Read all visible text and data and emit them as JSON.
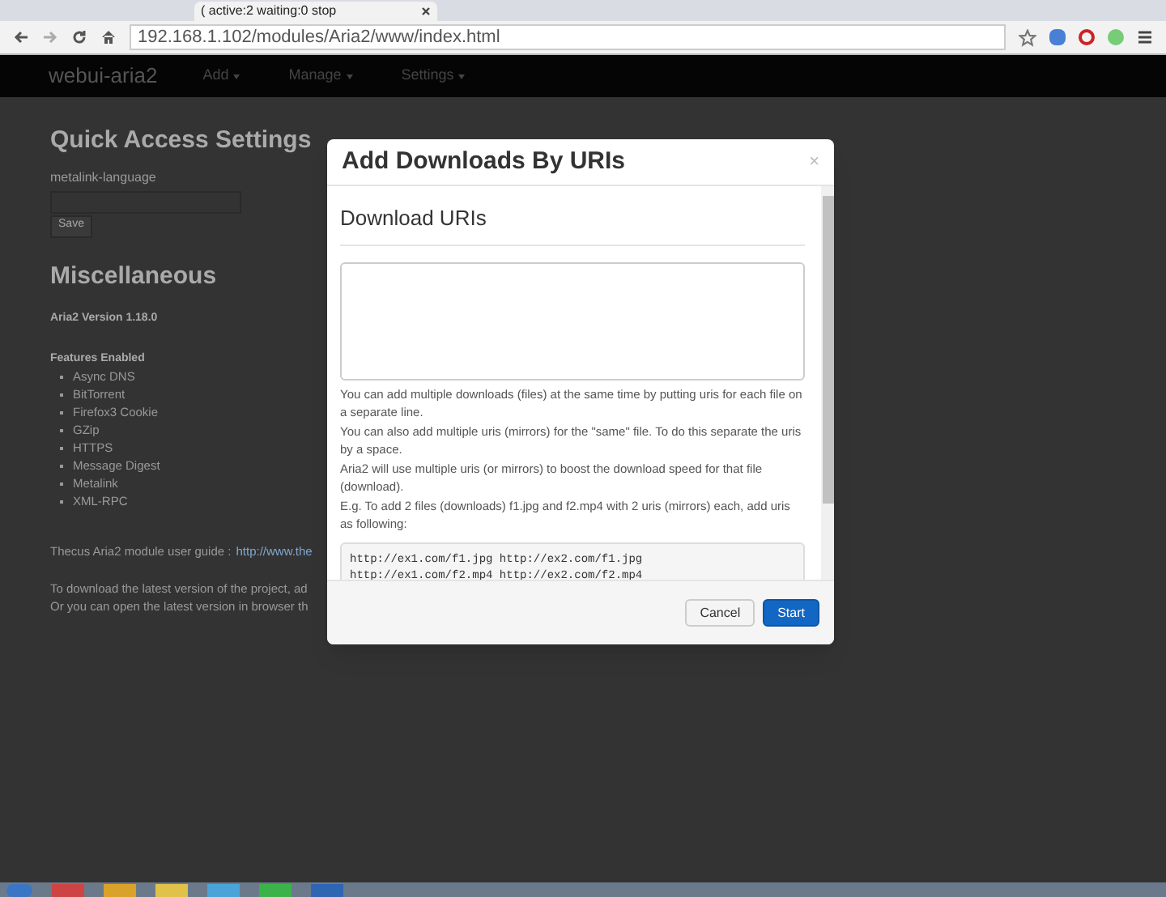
{
  "browser": {
    "tab_title": "( active:2 waiting:0 stop",
    "address": "192.168.1.102/modules/Aria2/www/index.html"
  },
  "navbar": {
    "brand": "webui-aria2",
    "menus": [
      {
        "label": "Add"
      },
      {
        "label": "Manage"
      },
      {
        "label": "Settings"
      }
    ]
  },
  "page": {
    "quick_access": {
      "heading": "Quick Access Settings",
      "field_label": "metalink-language",
      "save": "Save"
    },
    "misc": {
      "heading": "Miscellaneous",
      "version": "Aria2 Version 1.18.0",
      "features_heading": "Features Enabled",
      "features": [
        "Async DNS",
        "BitTorrent",
        "Firefox3 Cookie",
        "GZip",
        "HTTPS",
        "Message Digest",
        "Metalink",
        "XML-RPC"
      ],
      "guide_text": "Thecus Aria2 module user guide :",
      "guide_link": "http://www.the",
      "lines": [
        "To download the latest version of the project, ad",
        "Or you can open the latest version in browser th"
      ]
    }
  },
  "modal": {
    "title": "Add Downloads By URIs",
    "close": "×",
    "section": "Download URIs",
    "help": [
      "You can add multiple downloads (files) at the same time by putting uris for each file on a separate line.",
      "You can also add multiple uris (mirrors) for the \"same\" file. To do this separate the uris by a space.",
      "Aria2 will use multiple uris (or mirrors) to boost the download speed for that file (download).",
      "E.g. To add 2 files (downloads) f1.jpg and f2.mp4 with 2 uris (mirrors) each, add uris as following:"
    ],
    "code": [
      "http://ex1.com/f1.jpg http://ex2.com/f1.jpg",
      "http://ex1.com/f2.mp4 http://ex2.com/f2.mp4"
    ],
    "buttons": [
      {
        "label": "Cancel",
        "kind": "default"
      },
      {
        "label": "Start",
        "kind": "primary"
      }
    ]
  }
}
